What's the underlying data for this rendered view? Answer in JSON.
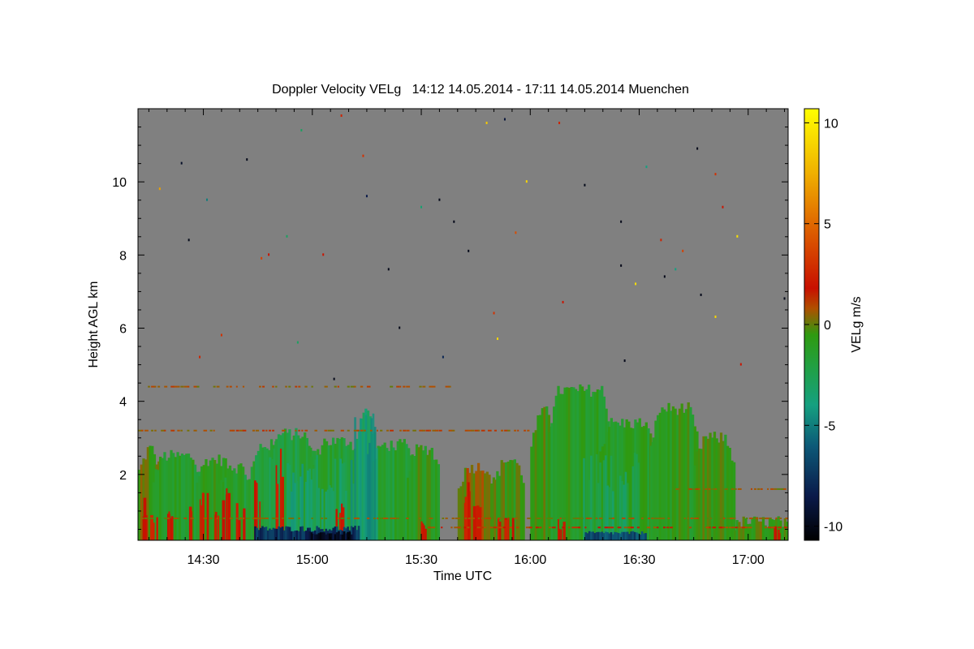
{
  "chart_data": {
    "type": "heatmap",
    "title": "Doppler Velocity VELg   14:12 14.05.2014 - 17:11 14.05.2014 Muenchen",
    "xlabel": "Time UTC",
    "ylabel": "Height AGL km",
    "colorbar_label": "VELg m/s",
    "x_range_minutes": [
      852,
      1031
    ],
    "ylim": [
      0.2,
      12.0
    ],
    "clim": [
      -10.7,
      10.7
    ],
    "background_color": "#808080",
    "x_ticks": [
      {
        "minutes": 870,
        "label": "14:30"
      },
      {
        "minutes": 900,
        "label": "15:00"
      },
      {
        "minutes": 930,
        "label": "15:30"
      },
      {
        "minutes": 960,
        "label": "16:00"
      },
      {
        "minutes": 990,
        "label": "16:30"
      },
      {
        "minutes": 1020,
        "label": "17:00"
      }
    ],
    "y_ticks": [
      {
        "value": 2,
        "label": "2"
      },
      {
        "value": 4,
        "label": "4"
      },
      {
        "value": 6,
        "label": "6"
      },
      {
        "value": 8,
        "label": "8"
      },
      {
        "value": 10,
        "label": "10"
      }
    ],
    "colorbar_ticks": [
      {
        "value": 10,
        "label": "10"
      },
      {
        "value": 5,
        "label": "5"
      },
      {
        "value": 0,
        "label": "0"
      },
      {
        "value": -5,
        "label": "-5"
      },
      {
        "value": -10,
        "label": "-10"
      }
    ],
    "colormap": [
      {
        "v": -10.7,
        "c": "#000000"
      },
      {
        "v": -8.5,
        "c": "#0a1a4a"
      },
      {
        "v": -6.0,
        "c": "#0d5a78"
      },
      {
        "v": -4.0,
        "c": "#15a080"
      },
      {
        "v": -2.0,
        "c": "#22a040"
      },
      {
        "v": -0.5,
        "c": "#2f9a10"
      },
      {
        "v": 0.8,
        "c": "#b05000"
      },
      {
        "v": 1.8,
        "c": "#c81000"
      },
      {
        "v": 4.5,
        "c": "#dc5a00"
      },
      {
        "v": 7.5,
        "c": "#f0b000"
      },
      {
        "v": 10.7,
        "c": "#ffff00"
      }
    ],
    "cloud_regions": [
      {
        "t0": 852,
        "t1": 858,
        "top": 2.7,
        "v": -0.3
      },
      {
        "t0": 856,
        "t1": 869,
        "top": 2.5,
        "v": -1.2
      },
      {
        "t0": 868,
        "t1": 878,
        "top": 2.4,
        "v": -1.0
      },
      {
        "t0": 874,
        "t1": 883,
        "top": 2.2,
        "v": -1.5
      },
      {
        "t0": 883,
        "t1": 902,
        "top": 2.8,
        "v": -1.8
      },
      {
        "t0": 888,
        "t1": 900,
        "top": 3.1,
        "v": -2.0
      },
      {
        "t0": 900,
        "t1": 913,
        "top": 2.9,
        "v": -1.6
      },
      {
        "t0": 912,
        "t1": 917,
        "top": 3.9,
        "v": -3.0
      },
      {
        "t0": 916,
        "t1": 928,
        "top": 2.8,
        "v": -1.5
      },
      {
        "t0": 926,
        "t1": 935,
        "top": 2.7,
        "v": -0.8
      },
      {
        "t0": 940,
        "t1": 950,
        "top": 2.2,
        "v": 0.4
      },
      {
        "t0": 950,
        "t1": 958,
        "top": 2.4,
        "v": -0.5
      },
      {
        "t0": 960,
        "t1": 967,
        "top": 3.7,
        "v": -0.6
      },
      {
        "t0": 965,
        "t1": 982,
        "top": 4.3,
        "v": -1.0
      },
      {
        "t0": 979,
        "t1": 994,
        "top": 3.4,
        "v": -1.1
      },
      {
        "t0": 993,
        "t1": 1006,
        "top": 3.8,
        "v": -0.9
      },
      {
        "t0": 1005,
        "t1": 1016,
        "top": 3.0,
        "v": -0.6
      },
      {
        "t0": 1016,
        "t1": 1031,
        "top": 0.7,
        "v": -0.4
      }
    ],
    "updraft_cores": [
      {
        "t0": 893,
        "t1": 915,
        "top": 2.6,
        "v": -3.4
      },
      {
        "t0": 910,
        "t1": 918,
        "top": 3.7,
        "v": -4.2
      },
      {
        "t0": 974,
        "t1": 990,
        "top": 2.6,
        "v": -2.8
      }
    ],
    "downdraft_streaks": [
      {
        "t": 853,
        "top": 1.4,
        "v": 2.0
      },
      {
        "t": 856,
        "top": 0.9,
        "v": 2.5
      },
      {
        "t": 861,
        "top": 1.0,
        "v": 2.2
      },
      {
        "t": 866,
        "top": 1.3,
        "v": 2.0
      },
      {
        "t": 870,
        "top": 1.6,
        "v": 2.3
      },
      {
        "t": 873,
        "top": 1.2,
        "v": 2.1
      },
      {
        "t": 876,
        "top": 1.8,
        "v": 1.8
      },
      {
        "t": 880,
        "top": 1.3,
        "v": 2.0
      },
      {
        "t": 885,
        "top": 1.9,
        "v": 1.9
      },
      {
        "t": 891,
        "top": 2.9,
        "v": 2.0
      },
      {
        "t": 907,
        "top": 1.6,
        "v": 1.7
      },
      {
        "t": 930,
        "top": 0.8,
        "v": 2.0
      },
      {
        "t": 942,
        "top": 1.9,
        "v": 2.2
      },
      {
        "t": 945,
        "top": 1.2,
        "v": 2.4
      },
      {
        "t": 952,
        "top": 1.0,
        "v": 2.0
      },
      {
        "t": 954,
        "top": 0.9,
        "v": 2.2
      },
      {
        "t": 968,
        "top": 0.8,
        "v": 1.8
      },
      {
        "t": 1028,
        "top": 0.6,
        "v": 1.9
      }
    ],
    "strong_base_updraft": [
      {
        "t0": 884,
        "t1": 913,
        "top": 0.6,
        "v": -7.5
      },
      {
        "t0": 899,
        "t1": 911,
        "top": 0.45,
        "v": -9.5
      },
      {
        "t0": 975,
        "t1": 992,
        "top": 0.45,
        "v": -6.5
      }
    ],
    "noise_layers": [
      {
        "t0": 852,
        "t1": 940,
        "h": 4.4,
        "v": 0.6
      },
      {
        "t0": 852,
        "t1": 960,
        "h": 3.2,
        "v": 0.8
      },
      {
        "t0": 852,
        "t1": 1031,
        "h": 0.8,
        "v": 0.4
      },
      {
        "t0": 930,
        "t1": 1031,
        "h": 0.55,
        "v": 1.2
      },
      {
        "t0": 1000,
        "t1": 1031,
        "h": 1.6,
        "v": 0.5
      }
    ],
    "isolated_points": [
      {
        "t": 864,
        "h": 10.5,
        "v": -9.5
      },
      {
        "t": 882,
        "h": 10.6,
        "v": -10.0
      },
      {
        "t": 858,
        "h": 9.8,
        "v": 7.0
      },
      {
        "t": 866,
        "h": 8.4,
        "v": -10.0
      },
      {
        "t": 875,
        "h": 5.8,
        "v": 3.0
      },
      {
        "t": 897,
        "h": 11.4,
        "v": -3.0
      },
      {
        "t": 906,
        "h": 4.6,
        "v": -10.0
      },
      {
        "t": 908,
        "h": 11.8,
        "v": 2.5
      },
      {
        "t": 914,
        "h": 10.7,
        "v": 3.0
      },
      {
        "t": 915,
        "h": 9.6,
        "v": -8.5
      },
      {
        "t": 921,
        "h": 7.6,
        "v": -10.0
      },
      {
        "t": 924,
        "h": 6.0,
        "v": -10.0
      },
      {
        "t": 930,
        "h": 9.3,
        "v": -3.5
      },
      {
        "t": 935,
        "h": 9.5,
        "v": -10.0
      },
      {
        "t": 936,
        "h": 5.2,
        "v": -8.0
      },
      {
        "t": 939,
        "h": 8.9,
        "v": -10.0
      },
      {
        "t": 943,
        "h": 8.1,
        "v": -10.0
      },
      {
        "t": 948,
        "h": 11.6,
        "v": 8.5
      },
      {
        "t": 950,
        "h": 6.4,
        "v": 3.0
      },
      {
        "t": 951,
        "h": 5.7,
        "v": 9.0
      },
      {
        "t": 953,
        "h": 11.7,
        "v": -9.0
      },
      {
        "t": 956,
        "h": 8.6,
        "v": 4.0
      },
      {
        "t": 959,
        "h": 10.0,
        "v": 9.0
      },
      {
        "t": 968,
        "h": 11.6,
        "v": 2.5
      },
      {
        "t": 969,
        "h": 6.7,
        "v": 2.0
      },
      {
        "t": 975,
        "h": 9.9,
        "v": -10.0
      },
      {
        "t": 985,
        "h": 8.9,
        "v": -10.0
      },
      {
        "t": 985,
        "h": 7.7,
        "v": -10.0
      },
      {
        "t": 986,
        "h": 5.1,
        "v": -10.0
      },
      {
        "t": 989,
        "h": 7.2,
        "v": 9.5
      },
      {
        "t": 992,
        "h": 10.4,
        "v": -4.0
      },
      {
        "t": 996,
        "h": 8.4,
        "v": 2.5
      },
      {
        "t": 997,
        "h": 7.4,
        "v": -10.0
      },
      {
        "t": 1000,
        "h": 7.6,
        "v": -4.0
      },
      {
        "t": 1002,
        "h": 8.1,
        "v": 3.5
      },
      {
        "t": 1006,
        "h": 10.9,
        "v": -10.0
      },
      {
        "t": 1007,
        "h": 6.9,
        "v": -10.0
      },
      {
        "t": 1011,
        "h": 10.2,
        "v": 3.0
      },
      {
        "t": 1011,
        "h": 6.3,
        "v": 9.0
      },
      {
        "t": 1013,
        "h": 9.3,
        "v": 2.0
      },
      {
        "t": 1017,
        "h": 8.5,
        "v": 9.5
      },
      {
        "t": 1030,
        "h": 6.8,
        "v": -10.0
      },
      {
        "t": 1018,
        "h": 5.0,
        "v": 2.0
      },
      {
        "t": 869,
        "h": 5.2,
        "v": 2.5
      },
      {
        "t": 888,
        "h": 8.0,
        "v": 2.0
      },
      {
        "t": 893,
        "h": 8.5,
        "v": -3.0
      },
      {
        "t": 903,
        "h": 8.0,
        "v": 2.0
      },
      {
        "t": 886,
        "h": 7.9,
        "v": 3.5
      },
      {
        "t": 896,
        "h": 5.6,
        "v": -3.0
      },
      {
        "t": 871,
        "h": 9.5,
        "v": -5.0
      }
    ]
  }
}
